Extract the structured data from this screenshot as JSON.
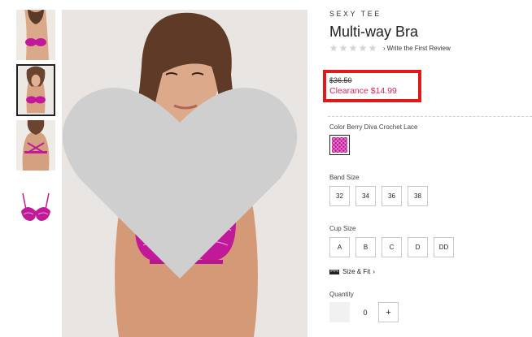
{
  "product": {
    "brand": "SEXY TEE",
    "title": "Multi-way Bra",
    "review_link": "Write the First Review",
    "original_price": "$36.50",
    "sale_price": "Clearance $14.99",
    "rating_stars": 0,
    "rating_max": 5
  },
  "colors": {
    "accent_pink": "#e0245e",
    "highlight_red": "#e01a1a",
    "bra_magenta": "#c2199a"
  },
  "color_selector": {
    "label": "Color Berry Diva Crochet Lace",
    "selected_swatch": "berry-diva-crochet-lace"
  },
  "band_size": {
    "label": "Band Size",
    "options": [
      "32",
      "34",
      "36",
      "38"
    ]
  },
  "cup_size": {
    "label": "Cup Size",
    "options": [
      "A",
      "B",
      "C",
      "D",
      "DD"
    ]
  },
  "size_fit": {
    "label": "Size & Fit",
    "icon": "ruler-icon",
    "arrow": "›"
  },
  "quantity": {
    "label": "Quantity",
    "value": "0",
    "plus": "+"
  },
  "icons": {
    "favorite": "heart-icon",
    "stars": "star-icon",
    "review_chevron": "chevron-right-icon"
  }
}
